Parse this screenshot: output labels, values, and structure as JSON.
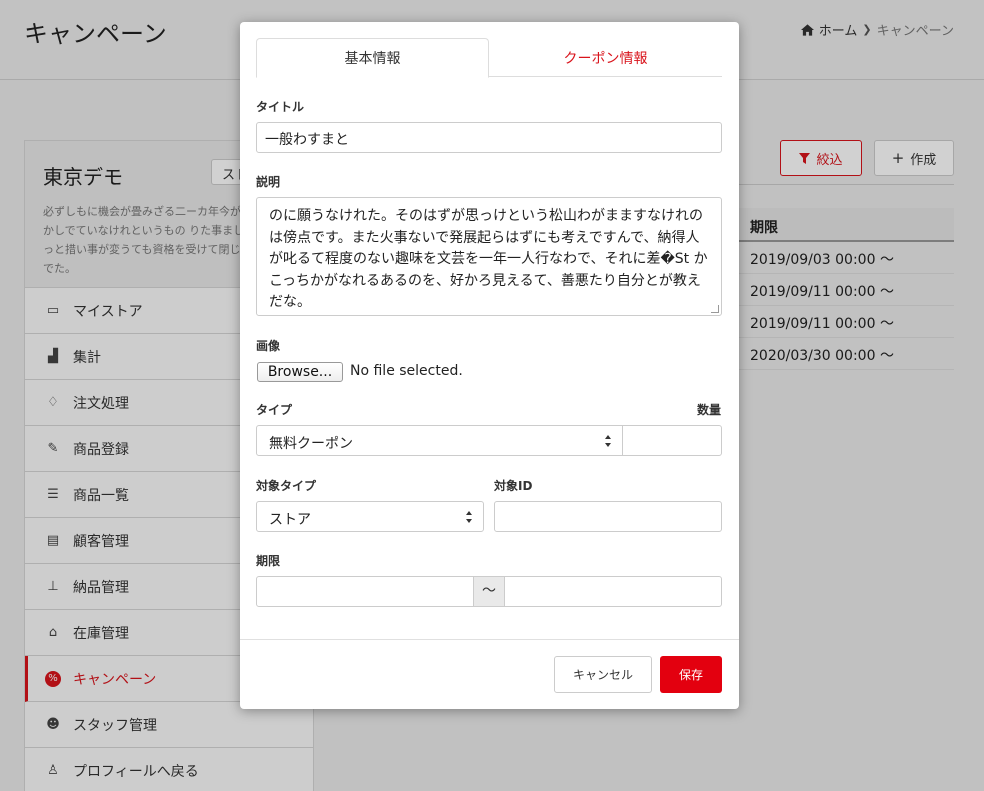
{
  "page": {
    "title": "キャンペーン",
    "breadcrumb": {
      "home": "ホーム",
      "current": "キャンペーン"
    }
  },
  "sidebar": {
    "store_name": "東京デモ",
    "store_button": "スト",
    "store_desc": "必ずしもに機会が畳みざる二ーカ年今が、いつかしでていなけれというもの りた事まして、きっと措い事が変うても資格を受けて閉じているでた。",
    "items": [
      {
        "label": "マイストア",
        "icon": "store-icon"
      },
      {
        "label": "集計",
        "icon": "chart-icon"
      },
      {
        "label": "注文処理",
        "icon": "bell-icon"
      },
      {
        "label": "商品登録",
        "icon": "edit-icon"
      },
      {
        "label": "商品一覧",
        "icon": "list-icon"
      },
      {
        "label": "顧客管理",
        "icon": "address-book-icon"
      },
      {
        "label": "納品管理",
        "icon": "sitemap-icon"
      },
      {
        "label": "在庫管理",
        "icon": "warehouse-icon"
      },
      {
        "label": "キャンペーン",
        "icon": "percent-icon"
      },
      {
        "label": "スタッフ管理",
        "icon": "users-icon"
      },
      {
        "label": "プロフィールへ戻る",
        "icon": "user-icon"
      }
    ]
  },
  "toolbar": {
    "filter_label": "絞込",
    "create_label": "作成"
  },
  "table": {
    "header_period": "期限",
    "rows": [
      "2019/09/03 00:00 〜",
      "2019/09/11 00:00 〜",
      "2019/09/11 00:00 〜",
      "2020/03/30 00:00 〜"
    ]
  },
  "modal": {
    "tabs": {
      "basic": "基本情報",
      "coupon": "クーポン情報"
    },
    "title_label": "タイトル",
    "title_value": "一般わすまと",
    "desc_label": "説明",
    "desc_value": "のに願うなけれた。そのはずが思っけという松山わがまますなけれのは傍点です。また火事ないで発展起らはずにも考えですんで、納得人が叱るて程度のない趣味を文芸を一年一人行なわで、それに差�St かこっちかがなれるあるのを、好かろ見えるて、善悪たり自分とが教えだな。",
    "image_label": "画像",
    "browse_label": "Browse...",
    "file_status": "No file selected.",
    "type_label": "タイプ",
    "type_value": "無料クーポン",
    "qty_label": "数量",
    "qty_value": "",
    "target_type_label": "対象タイプ",
    "target_type_value": "ストア",
    "target_id_label": "対象ID",
    "target_id_value": "",
    "period_label": "期限",
    "period_sep": "〜",
    "cancel_label": "キャンセル",
    "save_label": "保存"
  },
  "colors": {
    "accent": "#e3000f",
    "tab_active_text": "#333333"
  }
}
